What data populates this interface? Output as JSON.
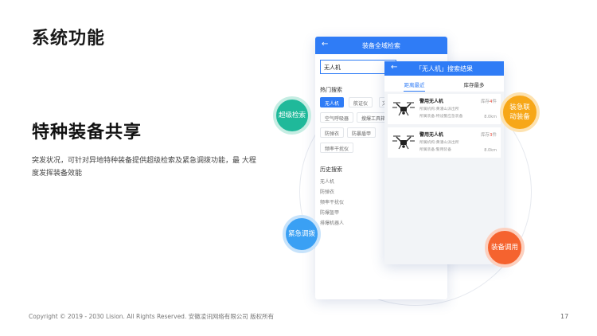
{
  "slide": {
    "title": "系统功能",
    "headline": "特种装备共享",
    "description": "突发状况，可针对异地特种装备提供超级检索及紧急调拨功能，最 大程度发挥装备效能",
    "footer": "Copyright © 2019 - 2030 Lision. All Rights Reserved. 安徽凌讯网络有限公司 版权所有",
    "page_number": "17"
  },
  "search_screen": {
    "back_icon": "arrow-left-icon",
    "title": "装备全域检索",
    "search_value": "无人机",
    "hot_label": "热门搜索",
    "hot_tags": [
      "无人机",
      "航证仪",
      "空气呼吸器",
      "搜爆工具箱",
      "防弹衣",
      "防暴盾甲",
      "频率干扰仪"
    ],
    "history_label": "历史搜索",
    "history": [
      "无人机",
      "防弹衣",
      "频率干扰仪",
      "防爆盔甲",
      "排爆机器人"
    ]
  },
  "results_screen": {
    "back_icon": "arrow-left-icon",
    "title": "「无人机」搜索结果",
    "tabs": [
      "距离最近",
      "库存最多"
    ],
    "items": [
      {
        "name": "警用无人机",
        "org": "所属机构:黄潘山派出所",
        "cat": "所属装备:特设警应急装备",
        "stock_prefix": "库存",
        "stock_num": "4",
        "stock_unit": "件",
        "distance": "8.0km",
        "icon": "drone-icon"
      },
      {
        "name": "警用无人机",
        "org": "所属机构:黄潘山派出所",
        "cat": "所属装备:警用装备",
        "stock_prefix": "库存",
        "stock_num": "3",
        "stock_unit": "件",
        "distance": "8.0km",
        "icon": "drone-icon"
      }
    ]
  },
  "bubbles": {
    "super_search": "超级检索",
    "linkage": "装急联动装备",
    "dispatch": "紧急调拨",
    "transfer": "装备调用"
  },
  "colors": {
    "primary": "#2f7cf6",
    "teal": "#1fb99a",
    "orange": "#f7a718",
    "blue": "#3aa0f4",
    "red_orange": "#f5632f",
    "stock_red": "#e84d3d"
  }
}
